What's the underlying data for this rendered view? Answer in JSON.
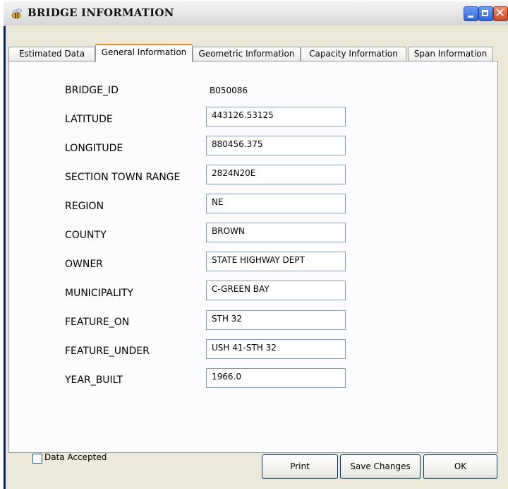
{
  "window": {
    "title": "BRIDGE INFORMATION",
    "controls": {
      "minimize": "minimize-icon",
      "maximize": "maximize-icon",
      "close": "close-icon"
    }
  },
  "tabs": [
    {
      "label": "Estimated Data",
      "active": false
    },
    {
      "label": "General Information",
      "active": true
    },
    {
      "label": "Geometric Information",
      "active": false
    },
    {
      "label": "Capacity Information",
      "active": false
    },
    {
      "label": "Span Information",
      "active": false
    }
  ],
  "general": {
    "bridge_id": {
      "label": "BRIDGE_ID",
      "value": "B050086"
    },
    "fields": [
      {
        "label": "LATITUDE",
        "value": "443126.53125"
      },
      {
        "label": "LONGITUDE",
        "value": "880456.375"
      },
      {
        "label": "SECTION TOWN RANGE",
        "value": "2824N20E"
      },
      {
        "label": "REGION",
        "value": "NE"
      },
      {
        "label": "COUNTY",
        "value": "BROWN"
      },
      {
        "label": "OWNER",
        "value": "STATE HIGHWAY DEPT"
      },
      {
        "label": "MUNICIPALITY",
        "value": "C-GREEN BAY"
      },
      {
        "label": "FEATURE_ON",
        "value": "STH 32"
      },
      {
        "label": "FEATURE_UNDER",
        "value": "USH 41-STH 32"
      },
      {
        "label": "YEAR_BUILT",
        "value": "1966.0"
      }
    ]
  },
  "footer": {
    "data_accepted_label": "Data Accepted",
    "data_accepted_checked": false,
    "print_label": "Print",
    "save_label": "Save Changes",
    "ok_label": "OK"
  },
  "colors": {
    "tab_accent": "#e68b2c",
    "title_blue": "#0a246a",
    "close_red": "#d0482a"
  }
}
